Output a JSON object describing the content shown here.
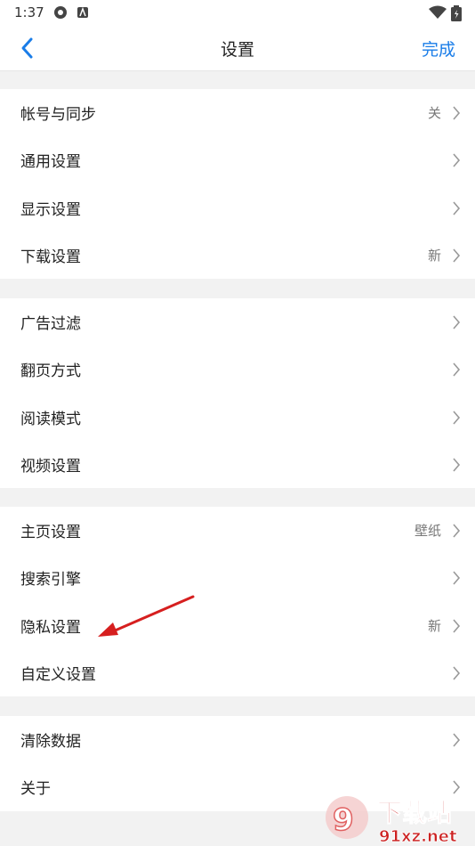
{
  "status": {
    "time": "1:37"
  },
  "navbar": {
    "title": "设置",
    "done_label": "完成"
  },
  "groups": [
    {
      "items": [
        {
          "label": "帐号与同步",
          "value": "关"
        },
        {
          "label": "通用设置",
          "value": ""
        },
        {
          "label": "显示设置",
          "value": ""
        },
        {
          "label": "下载设置",
          "value": "新"
        }
      ]
    },
    {
      "items": [
        {
          "label": "广告过滤",
          "value": ""
        },
        {
          "label": "翻页方式",
          "value": ""
        },
        {
          "label": "阅读模式",
          "value": ""
        },
        {
          "label": "视频设置",
          "value": ""
        }
      ]
    },
    {
      "items": [
        {
          "label": "主页设置",
          "value": "壁纸"
        },
        {
          "label": "搜索引擎",
          "value": ""
        },
        {
          "label": "隐私设置",
          "value": "新"
        },
        {
          "label": "自定义设置",
          "value": ""
        }
      ]
    },
    {
      "items": [
        {
          "label": "清除数据",
          "value": ""
        },
        {
          "label": "关于",
          "value": ""
        }
      ]
    }
  ],
  "watermark": {
    "text": "下载站",
    "domain": "91xz.net"
  },
  "colors": {
    "accent": "#1a7de8",
    "annotation_arrow": "#d61f1f"
  },
  "icons": [
    "back-arrow-icon",
    "chevron-right-icon",
    "wifi-icon",
    "battery-icon"
  ]
}
